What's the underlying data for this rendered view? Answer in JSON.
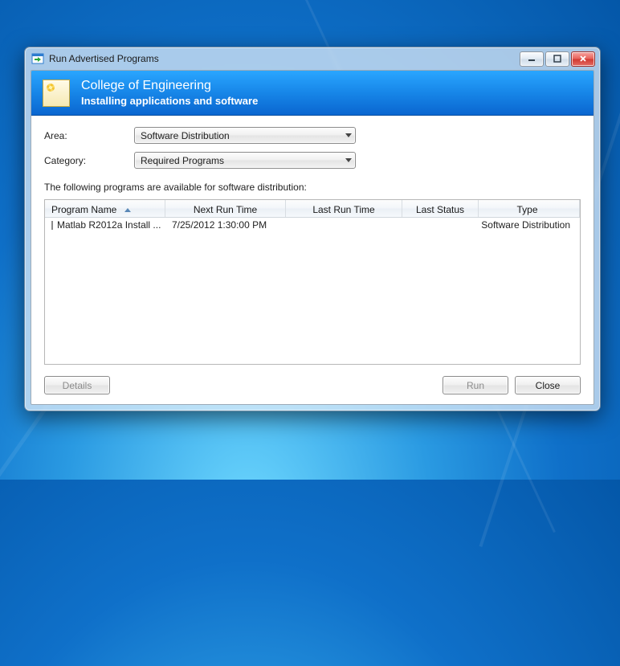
{
  "window": {
    "title": "Run Advertised Programs"
  },
  "banner": {
    "title": "College of Engineering",
    "subtitle": "Installing applications and software"
  },
  "form": {
    "area_label": "Area:",
    "area_value": "Software Distribution",
    "category_label": "Category:",
    "category_value": "Required Programs"
  },
  "list_description": "The following programs are available for software distribution:",
  "columns": {
    "program_name": "Program Name",
    "next_run": "Next Run Time",
    "last_run": "Last Run Time",
    "last_status": "Last Status",
    "type": "Type"
  },
  "rows": [
    {
      "name": "Matlab R2012a Install ...",
      "next_run": "7/25/2012 1:30:00 PM",
      "last_run": "",
      "last_status": "",
      "type": "Software Distribution"
    }
  ],
  "buttons": {
    "details": "Details",
    "run": "Run",
    "close": "Close"
  }
}
